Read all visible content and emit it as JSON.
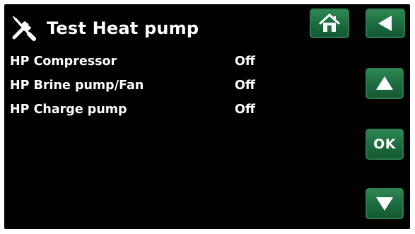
{
  "header": {
    "title": "Test Heat pump",
    "icon": "tools-icon"
  },
  "rows": [
    {
      "label": "HP Compressor",
      "value": "Off"
    },
    {
      "label": "HP Brine pump/Fan",
      "value": "Off"
    },
    {
      "label": "HP Charge pump",
      "value": "Off"
    }
  ],
  "buttons": {
    "home_icon": "home-icon",
    "back_icon": "arrow-left-icon",
    "up_icon": "arrow-up-icon",
    "ok_label": "OK",
    "down_icon": "arrow-down-icon"
  },
  "colors": {
    "screen_background": "#000000",
    "text": "#ffffff",
    "button_green": "#1d6a3e"
  }
}
